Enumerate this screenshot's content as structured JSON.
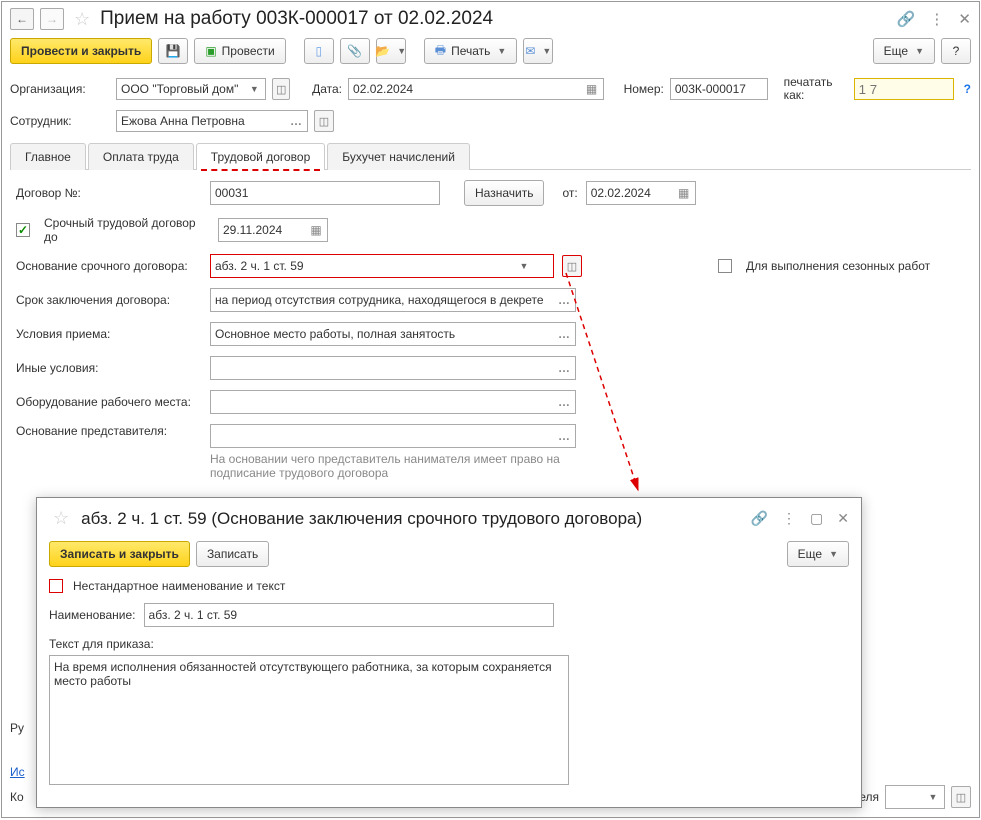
{
  "title": "Прием на работу 003К-000017 от 02.02.2024",
  "toolbar": {
    "post_close": "Провести и закрыть",
    "post": "Провести",
    "print": "Печать",
    "more": "Еще"
  },
  "header": {
    "org_label": "Организация:",
    "org_value": "ООО \"Торговый дом\"",
    "date_label": "Дата:",
    "date_value": "02.02.2024",
    "number_label": "Номер:",
    "number_value": "003К-000017",
    "print_as_label": "печатать как:",
    "print_as_placeholder": "1 7",
    "employee_label": "Сотрудник:",
    "employee_value": "Ежова Анна Петровна"
  },
  "tabs": {
    "main": "Главное",
    "salary": "Оплата труда",
    "contract": "Трудовой договор",
    "accounting": "Бухучет начислений"
  },
  "contract": {
    "num_label": "Договор №:",
    "num_value": "00031",
    "assign": "Назначить",
    "from_label": "от:",
    "from_value": "02.02.2024",
    "fixed_term_chk": "Срочный трудовой договор до",
    "fixed_term_date": "29.11.2024",
    "basis_label": "Основание срочного договора:",
    "basis_value": "абз. 2 ч. 1 ст. 59",
    "seasonal_chk": "Для выполнения сезонных работ",
    "term_label": "Срок заключения договора:",
    "term_value": "на период отсутствия сотрудника, находящегося в декрете",
    "conditions_label": "Условия приема:",
    "conditions_value": "Основное место работы, полная занятость",
    "other_label": "Иные условия:",
    "equipment_label": "Оборудование рабочего места:",
    "rep_basis_label": "Основание представителя:",
    "rep_basis_hint": "На основании чего представитель нанимателя имеет право на подписание трудового договора"
  },
  "footer": {
    "signer_label": "Руководитель:",
    "source_label": "Исправление",
    "comment_label": "Комментарий:",
    "responsible_suffix": "ателя"
  },
  "popup": {
    "title": "абз. 2 ч. 1 ст. 59 (Основание заключения срочного трудового договора)",
    "write_close": "Записать и закрыть",
    "write": "Записать",
    "more": "Еще",
    "nonstd_chk": "Нестандартное наименование и текст",
    "name_label": "Наименование:",
    "name_value": "абз. 2 ч. 1 ст. 59",
    "text_label": "Текст для приказа:",
    "text_value": "На время исполнения обязанностей отсутствующего работника, за которым сохраняется место работы"
  }
}
